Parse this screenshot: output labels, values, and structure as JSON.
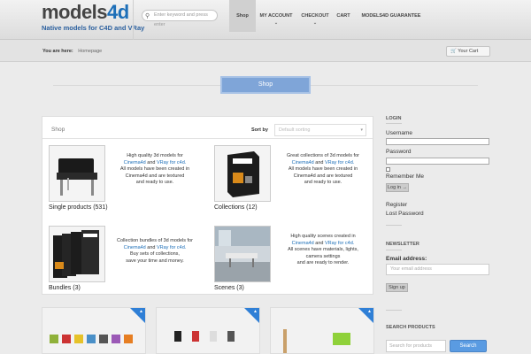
{
  "logo": {
    "main": "models",
    "accent": "4d",
    "tagline": "Native models for C4D and VRay"
  },
  "search": {
    "placeholder": "Enter keyword and press enter"
  },
  "nav": [
    {
      "label": "Shop",
      "active": true
    },
    {
      "label": "MY ACCOUNT",
      "dropdown": true
    },
    {
      "label": "CHECKOUT",
      "dropdown": true
    },
    {
      "label": "CART"
    },
    {
      "label": "MODELS4D GUARANTEE"
    }
  ],
  "breadcrumb": {
    "prefix": "You are here:",
    "home": "Homepage"
  },
  "cart": {
    "label": "Your Cart"
  },
  "page_title": "Shop",
  "shop": {
    "title": "Shop",
    "sort_label": "Sort by",
    "sort_placeholder": "Default sorting",
    "categories": [
      {
        "label": "Single products (531)",
        "desc": [
          "High quality 3d models for",
          "Cinema4d|and|VRay for c4d.",
          "All models have been created in",
          "Cinema4d and are textured",
          "and ready to use."
        ]
      },
      {
        "label": "Collections (12)",
        "desc": [
          "Great collections of 3d models for",
          "Cinema4d|and|VRay for c4d.",
          "All models have been created in",
          "Cinema4d and are textured",
          "and ready to use."
        ]
      },
      {
        "label": "Bundles (3)",
        "desc": [
          "Collection bundles of 3d models for",
          "Cinema4d|and|VRay for c4d.",
          "Buy sets of collections,",
          "save your time and money."
        ]
      },
      {
        "label": "Scenes (3)",
        "desc": [
          "High quality scenes created in",
          "Cinema4d|and|VRay for c4d.",
          "All scenes have materials, lights,",
          "camera settings",
          "and are ready to render."
        ]
      }
    ]
  },
  "sidebar": {
    "login": {
      "heading": "LOGIN",
      "username_label": "Username",
      "password_label": "Password",
      "remember_label": "Remember Me",
      "login_button": "Log in →",
      "register": "Register",
      "lost_password": "Lost Password"
    },
    "newsletter": {
      "heading": "NEWSLETTER",
      "email_label": "Email address:",
      "email_placeholder": "Your email address",
      "signup_button": "Sign up"
    },
    "search_products": {
      "heading": "SEARCH PRODUCTS",
      "placeholder": "Search for products",
      "button": "Search"
    }
  },
  "colors": {
    "accent": "#1d6fb8",
    "ribbon": "#7fa5d8",
    "button": "#5a9be2"
  }
}
